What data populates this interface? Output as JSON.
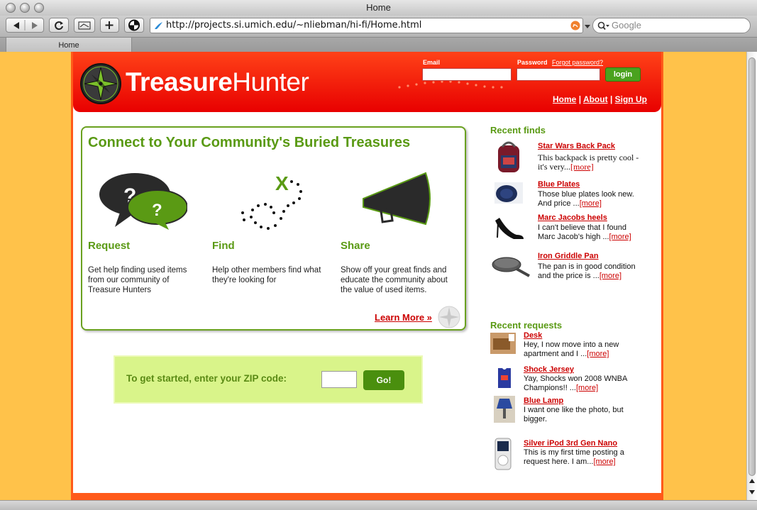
{
  "window": {
    "title": "Home"
  },
  "toolbar": {
    "url": "http://projects.si.umich.edu/~nliebman/hi-fi/Home.html",
    "search_placeholder": "Google",
    "back_icon": "back-arrow-icon",
    "forward_icon": "forward-arrow-icon",
    "reload_icon": "reload-icon",
    "add_icon": "plus-icon"
  },
  "tabs": [
    {
      "label": "Home"
    }
  ],
  "header": {
    "logo_bold": "Treasure",
    "logo_light": "Hunter",
    "email_label": "Email",
    "password_label": "Password",
    "forgot": "Forgot password?",
    "login": "login",
    "nav": [
      "Home",
      "About",
      "Sign Up"
    ],
    "nav_sep": "|"
  },
  "intro": {
    "title": "Connect to Your Community's Buried Treasures",
    "columns": [
      {
        "heading": "Request",
        "text": "Get help finding used items from our community of Treasure Hunters"
      },
      {
        "heading": "Find",
        "text": "Help other members find what they're looking for"
      },
      {
        "heading": "Share",
        "text": "Show off your great finds and educate the community about the value of used items."
      }
    ],
    "learn_more": "Learn More »",
    "find_mark": "X"
  },
  "zip": {
    "label": "To get started, enter your ZIP code:",
    "button": "Go!"
  },
  "recent_finds": {
    "heading": "Recent finds",
    "items": [
      {
        "title": "Star Wars Back Pack",
        "text": "This backpack is pretty cool - it's very...",
        "more": "[more]"
      },
      {
        "title": "Blue Plates",
        "text": "Those blue plates look new. And price ...",
        "more": "[more]"
      },
      {
        "title": "Marc Jacobs heels",
        "text": "I can't believe that I found Marc Jacob's high ...",
        "more": "[more]"
      },
      {
        "title": "Iron Griddle Pan",
        "text": "The pan is in good condition and the price is ...",
        "more": "[more]"
      }
    ]
  },
  "recent_requests": {
    "heading": "Recent requests",
    "items": [
      {
        "title": "Desk",
        "text": "Hey, I now move into a new apartment and I ...",
        "more": "[more]"
      },
      {
        "title": "Shock Jersey",
        "text": "Yay, Shocks won 2008 WNBA Champions!!  ...",
        "more": "[more]"
      },
      {
        "title": "Blue Lamp",
        "text": "I want one like the photo, but bigger.",
        "more": ""
      },
      {
        "title": "Silver iPod 3rd Gen Nano",
        "text": "This is my first time posting a request here. I am...",
        "more": "[more]"
      }
    ]
  },
  "colors": {
    "brand_red": "#e80000",
    "brand_green": "#5a9a14",
    "background": "#ffc24a"
  }
}
